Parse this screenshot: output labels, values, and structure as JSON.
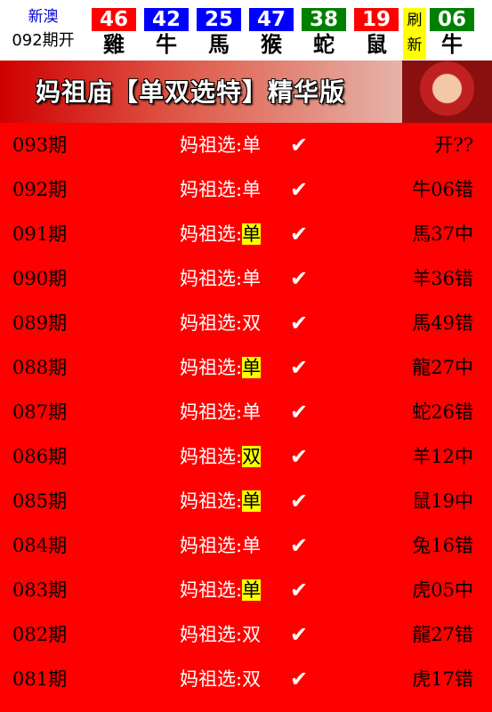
{
  "header": {
    "brand_line1": "新澳",
    "brand_line2": "092期开",
    "balls": [
      {
        "num": "46",
        "zodiac": "雞",
        "color": "#ff0000"
      },
      {
        "num": "42",
        "zodiac": "牛",
        "color": "#0000ff"
      },
      {
        "num": "25",
        "zodiac": "馬",
        "color": "#0000ff"
      },
      {
        "num": "47",
        "zodiac": "猴",
        "color": "#0000ff"
      },
      {
        "num": "38",
        "zodiac": "蛇",
        "color": "#008000"
      },
      {
        "num": "19",
        "zodiac": "鼠",
        "color": "#ff0000"
      },
      {
        "num": "06",
        "zodiac": "牛",
        "color": "#008000"
      }
    ],
    "refresh_line1": "刷",
    "refresh_line2": "新"
  },
  "banner": {
    "title": "妈祖庙【单双选特】精华版"
  },
  "rows": [
    {
      "period": "093期",
      "label": "妈祖选:",
      "pick": "单",
      "highlight": false,
      "check": "✔",
      "result": "开??"
    },
    {
      "period": "092期",
      "label": "妈祖选:",
      "pick": "单",
      "highlight": false,
      "check": "✔",
      "result": "牛06错"
    },
    {
      "period": "091期",
      "label": "妈祖选:",
      "pick": "单",
      "highlight": true,
      "check": "✔",
      "result": "馬37中"
    },
    {
      "period": "090期",
      "label": "妈祖选:",
      "pick": "单",
      "highlight": false,
      "check": "✔",
      "result": "羊36错"
    },
    {
      "period": "089期",
      "label": "妈祖选:",
      "pick": "双",
      "highlight": false,
      "check": "✔",
      "result": "馬49错"
    },
    {
      "period": "088期",
      "label": "妈祖选:",
      "pick": "单",
      "highlight": true,
      "check": "✔",
      "result": "龍27中"
    },
    {
      "period": "087期",
      "label": "妈祖选:",
      "pick": "单",
      "highlight": false,
      "check": "✔",
      "result": "蛇26错"
    },
    {
      "period": "086期",
      "label": "妈祖选:",
      "pick": "双",
      "highlight": true,
      "check": "✔",
      "result": "羊12中"
    },
    {
      "period": "085期",
      "label": "妈祖选:",
      "pick": "单",
      "highlight": true,
      "check": "✔",
      "result": "鼠19中"
    },
    {
      "period": "084期",
      "label": "妈祖选:",
      "pick": "单",
      "highlight": false,
      "check": "✔",
      "result": "兔16错"
    },
    {
      "period": "083期",
      "label": "妈祖选:",
      "pick": "单",
      "highlight": true,
      "check": "✔",
      "result": "虎05中"
    },
    {
      "period": "082期",
      "label": "妈祖选:",
      "pick": "双",
      "highlight": false,
      "check": "✔",
      "result": "龍27错"
    },
    {
      "period": "081期",
      "label": "妈祖选:",
      "pick": "双",
      "highlight": false,
      "check": "✔",
      "result": "虎17错"
    }
  ]
}
